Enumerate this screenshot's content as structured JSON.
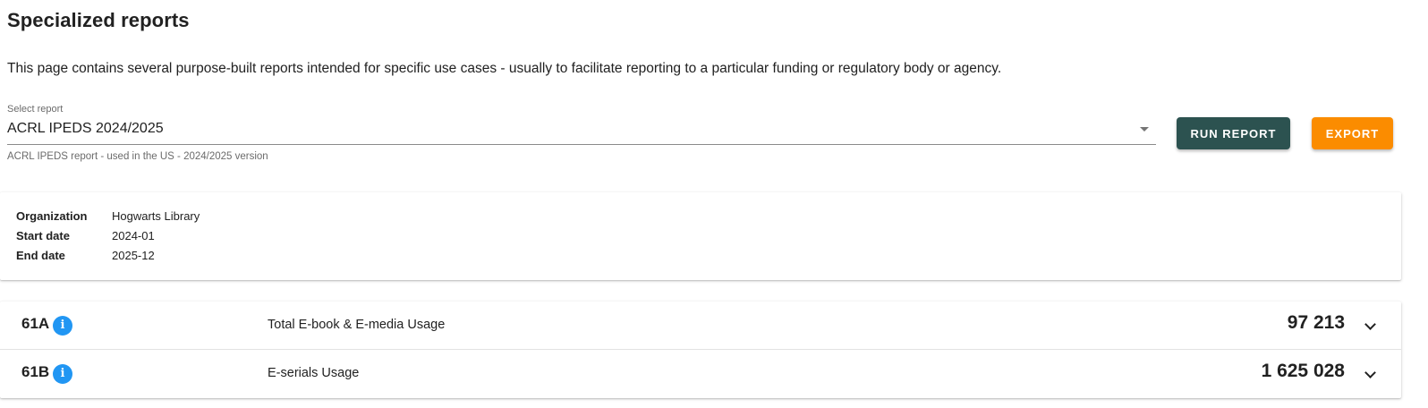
{
  "page": {
    "title": "Specialized reports",
    "description": "This page contains several purpose-built reports intended for specific use cases - usually to facilitate reporting to a particular funding or regulatory body or agency."
  },
  "report_select": {
    "label": "Select report",
    "value": "ACRL IPEDS 2024/2025",
    "hint": "ACRL IPEDS report - used in the US - 2024/2025 version"
  },
  "buttons": {
    "run_label": "RUN REPORT",
    "export_label": "EXPORT"
  },
  "colors": {
    "run_button": "#2c5250",
    "export_button": "#fb8c00",
    "info_icon": "#2196f3"
  },
  "summary": [
    {
      "key": "Organization",
      "value": "Hogwarts Library"
    },
    {
      "key": "Start date",
      "value": "2024-01"
    },
    {
      "key": "End date",
      "value": "2025-12"
    }
  ],
  "metrics": [
    {
      "code": "61A",
      "label": "Total E-book & E-media Usage",
      "value": "97 213",
      "icon": "info-icon",
      "expand_icon": "chevron-down-icon"
    },
    {
      "code": "61B",
      "label": "E-serials Usage",
      "value": "1 625 028",
      "icon": "info-icon",
      "expand_icon": "chevron-down-icon"
    }
  ]
}
